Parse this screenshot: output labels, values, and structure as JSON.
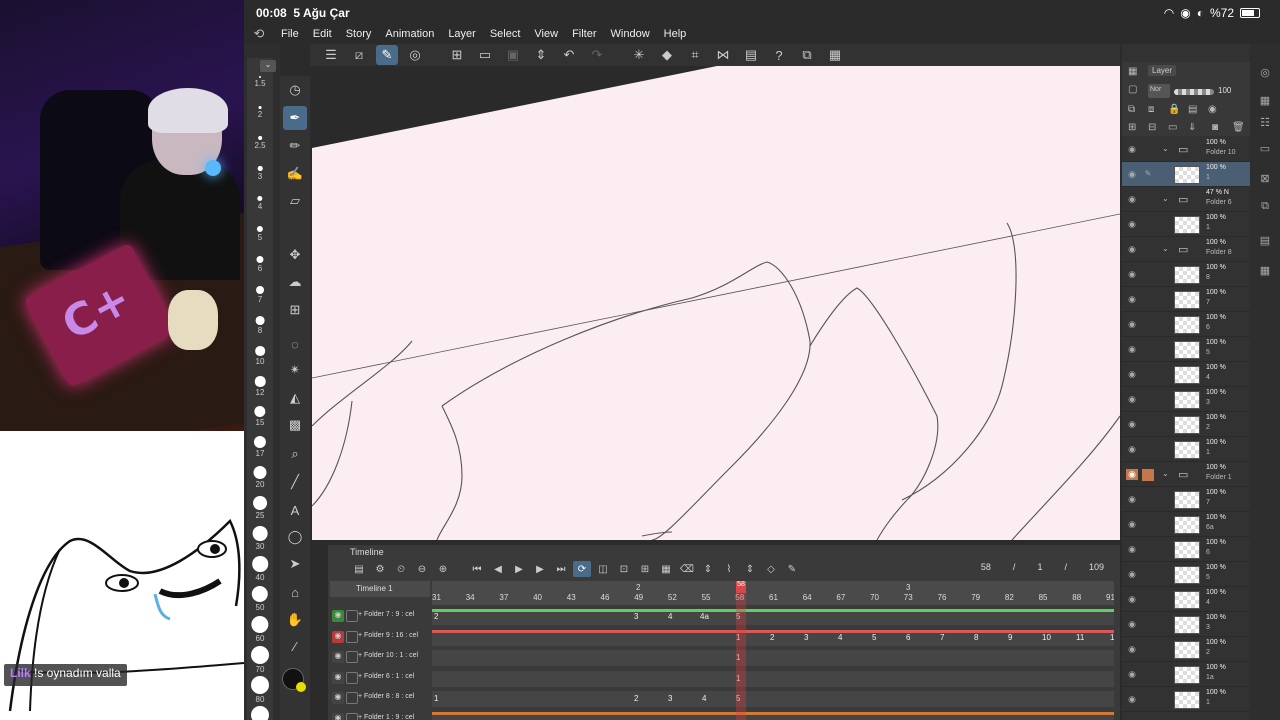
{
  "status": {
    "time": "00:08",
    "date": "5 Ağu Çar",
    "battery": "%72"
  },
  "menu": [
    "File",
    "Edit",
    "Story",
    "Animation",
    "Layer",
    "Select",
    "View",
    "Filter",
    "Window",
    "Help"
  ],
  "stream": {
    "mat_text": "C+",
    "chat_user": "Lilk",
    "chat_message": "!s oynadım valla"
  },
  "brush_sizes": [
    "1.5",
    "2",
    "2.5",
    "3",
    "4",
    "5",
    "6",
    "7",
    "8",
    "10",
    "12",
    "15",
    "17",
    "20",
    "25",
    "30",
    "40",
    "50",
    "60",
    "70",
    "80",
    "100"
  ],
  "timeline": {
    "title": "Timeline",
    "name": "Timeline 1",
    "current_frame": "58",
    "current_frame_count": "1",
    "total_frames": "109",
    "ruler_top": [
      "2",
      "58",
      "3"
    ],
    "ruler": [
      "31",
      "34",
      "37",
      "40",
      "43",
      "46",
      "49",
      "52",
      "55",
      "58",
      "61",
      "64",
      "67",
      "70",
      "73",
      "76",
      "79",
      "82",
      "85",
      "88",
      "91"
    ],
    "ruler_small": [
      "3c",
      "4a",
      "4b"
    ],
    "rows": [
      {
        "label": "Folder 7 : 9 : cel",
        "cels": [
          "2",
          "3",
          "4",
          "4a",
          "5"
        ]
      },
      {
        "label": "Folder 9 : 16 : cel",
        "cels": [
          "1",
          "2",
          "3",
          "4",
          "5",
          "6",
          "7",
          "8",
          "9",
          "10",
          "11",
          "1"
        ]
      },
      {
        "label": "Folder 10 : 1 : cel",
        "cels": [
          "1"
        ]
      },
      {
        "label": "Folder 6 : 1 : cel",
        "cels": [
          "1"
        ]
      },
      {
        "label": "Folder 8 : 8 : cel",
        "cels": [
          "1",
          "2",
          "3",
          "4",
          "5"
        ]
      },
      {
        "label": "Folder 1 : 9 : cel",
        "cels": []
      }
    ]
  },
  "layers": {
    "tab": "Layer",
    "blend": "Nor",
    "opacity": "100",
    "items": [
      {
        "pct": "100 %",
        "name": "Folder 10",
        "type": "folder"
      },
      {
        "pct": "100 %",
        "name": "1",
        "type": "layer",
        "selected": true
      },
      {
        "pct": "47 % N",
        "name": "Folder 6",
        "type": "folder"
      },
      {
        "pct": "100 %",
        "name": "1",
        "type": "layer"
      },
      {
        "pct": "100 %",
        "name": "Folder 8",
        "type": "folder"
      },
      {
        "pct": "100 %",
        "name": "8",
        "type": "layer"
      },
      {
        "pct": "100 %",
        "name": "7",
        "type": "layer"
      },
      {
        "pct": "100 %",
        "name": "6",
        "type": "layer"
      },
      {
        "pct": "100 %",
        "name": "5",
        "type": "layer"
      },
      {
        "pct": "100 %",
        "name": "4",
        "type": "layer"
      },
      {
        "pct": "100 %",
        "name": "3",
        "type": "layer"
      },
      {
        "pct": "100 %",
        "name": "2",
        "type": "layer"
      },
      {
        "pct": "100 %",
        "name": "1",
        "type": "layer"
      },
      {
        "pct": "100 %",
        "name": "Folder 1",
        "type": "folder",
        "orange": true
      },
      {
        "pct": "100 %",
        "name": "7",
        "type": "layer"
      },
      {
        "pct": "100 %",
        "name": "6a",
        "type": "layer"
      },
      {
        "pct": "100 %",
        "name": "6",
        "type": "layer"
      },
      {
        "pct": "100 %",
        "name": "5",
        "type": "layer"
      },
      {
        "pct": "100 %",
        "name": "4",
        "type": "layer"
      },
      {
        "pct": "100 %",
        "name": "3",
        "type": "layer"
      },
      {
        "pct": "100 %",
        "name": "2",
        "type": "layer"
      },
      {
        "pct": "100 %",
        "name": "1a",
        "type": "layer"
      },
      {
        "pct": "100 %",
        "name": "1",
        "type": "layer"
      }
    ]
  },
  "colors": {
    "main": "#111111",
    "sub": "#e6e000",
    "accent": "#4a6b8a",
    "playhead": "#d84848",
    "canvas": "#fcedf3"
  }
}
